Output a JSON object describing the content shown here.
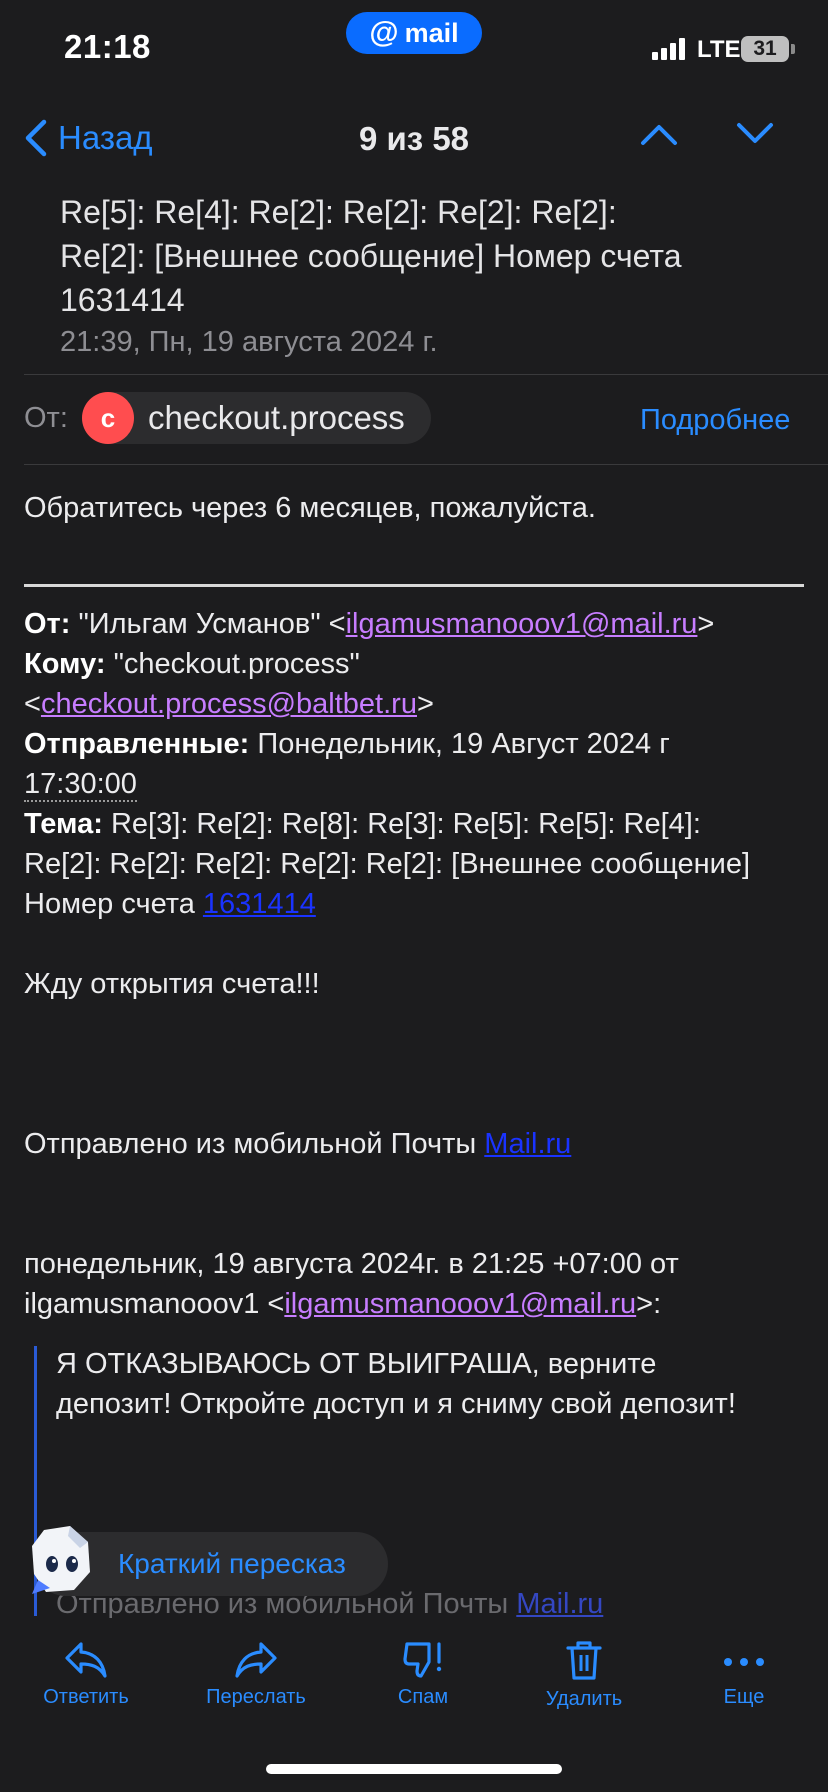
{
  "status_bar": {
    "time": "21:18",
    "app_badge": "mail",
    "network": "LTE",
    "battery": "31"
  },
  "nav": {
    "back_label": "Назад",
    "counter": "9 из 58"
  },
  "message": {
    "subject": "Re[5]: Re[4]: Re[2]: Re[2]: Re[2]: Re[2]: Re[2]: [Внешнее сообщение] Номер счета 1631414",
    "date": "21:39, Пн, 19 августа 2024 г.",
    "from_label": "От:",
    "from_initial": "c",
    "from_name": "checkout.process",
    "more_label": "Подробнее"
  },
  "body": {
    "reply_text": "Обратитесь через 6 месяцев, пожалуйста.",
    "hdr_from_label": "От:",
    "hdr_from_name": "\"Ильгам Усманов\" <",
    "hdr_from_email": "ilgamusmanooov1@mail.ru",
    "hdr_to_label": "Кому:",
    "hdr_to_name": "\"checkout.process\"",
    "hdr_to_email": "checkout.process@baltbet.ru",
    "hdr_sent_label": "Отправленные:",
    "hdr_sent_value": "Понедельник, 19 Август 2024 г",
    "hdr_sent_time": "17:30:00",
    "hdr_subject_label": "Тема:",
    "hdr_subject_value": "Re[3]: Re[2]: Re[8]: Re[3]: Re[5]: Re[5]: Re[4]: Re[2]: Re[2]: Re[2]: Re[2]: Re[2]: [Внешнее сообщение] Номер счета",
    "hdr_subject_number": "1631414",
    "wait_text": "Жду открытия счета!!!",
    "sent_from_text": "Отправлено из мобильной Почты",
    "sent_from_link": "Mail.ru",
    "orig_intro": "понедельник, 19 августа 2024г. в 21:25 +07:00 от ilgamusmanooov1 <",
    "orig_email": "ilgamusmanooov1@mail.ru",
    "orig_tail": ">:",
    "quote_text": "Я ОТКАЗЫВАЮСЬ ОТ ВЫИГРАША, верните депозит! Откройте доступ и я сниму свой депозит!",
    "sent_from_text_2": "Отправлено из мобильной Почты",
    "sent_from_link_2": "Mail.ru"
  },
  "summary_button": {
    "label": "Краткий пересказ"
  },
  "toolbar": {
    "reply": "Ответить",
    "forward": "Переслать",
    "spam": "Спам",
    "delete": "Удалить",
    "more": "Еще"
  },
  "colors": {
    "accent": "#2a8cff",
    "background": "#1c1c1e",
    "link": "#c77dff",
    "avatar": "#ff4d4f"
  },
  "icons": [
    "chevron-left-icon",
    "chevron-up-icon",
    "chevron-down-icon",
    "reply-icon",
    "forward-icon",
    "spam-icon",
    "trash-icon",
    "more-dots-icon"
  ]
}
